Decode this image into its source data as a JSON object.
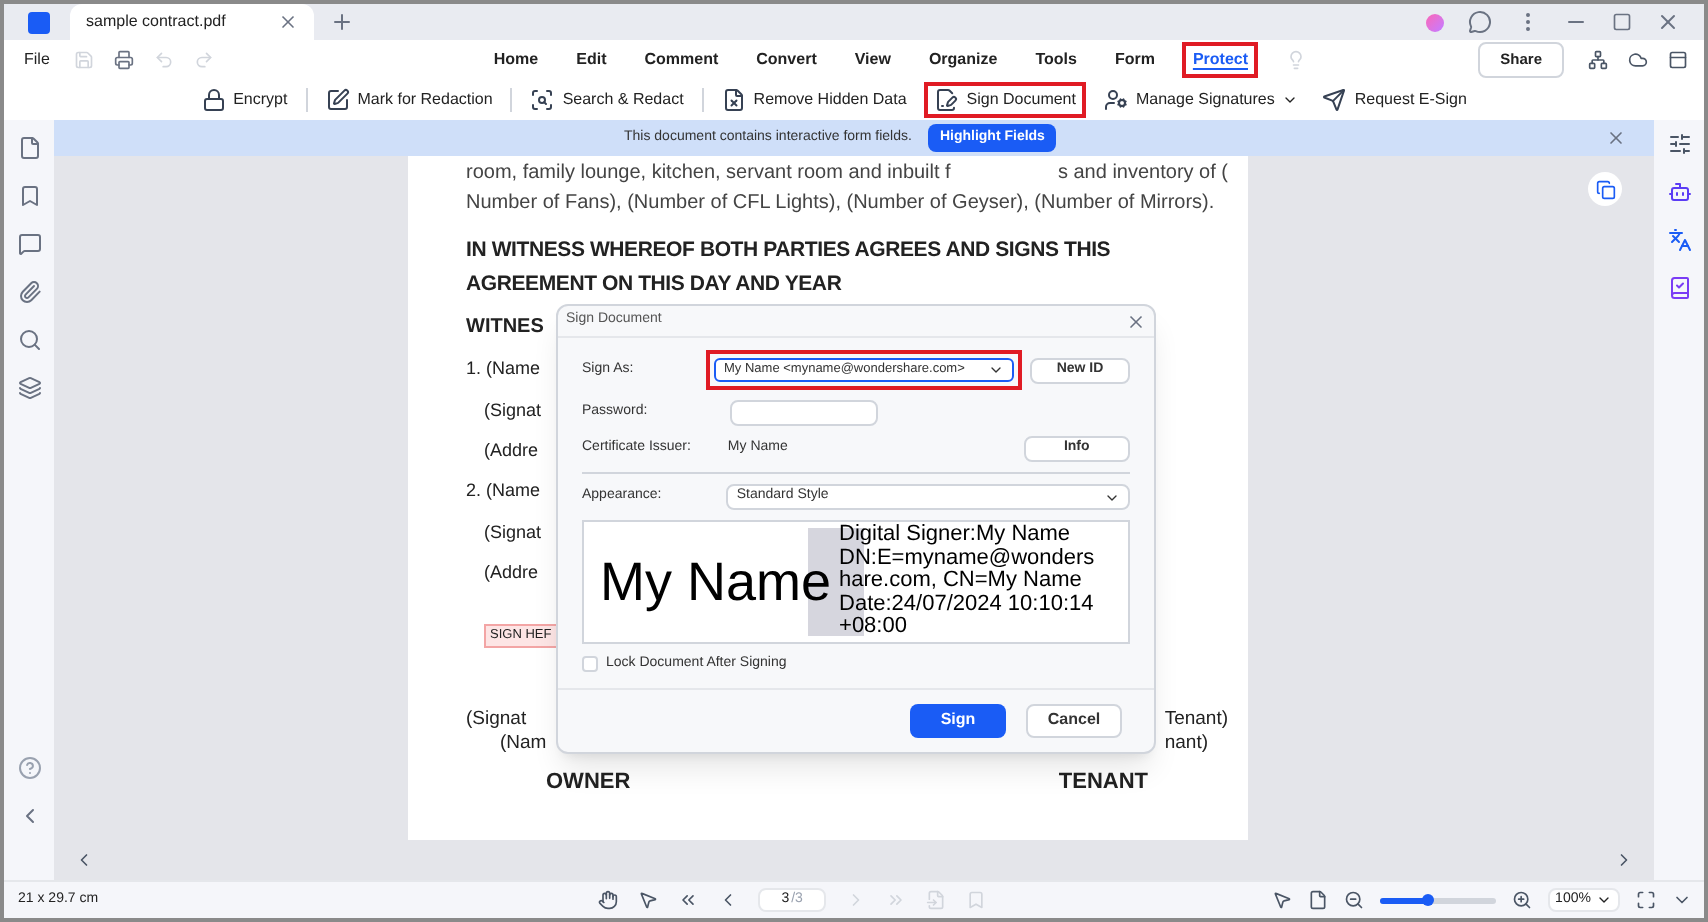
{
  "window": {
    "tab_title": "sample contract.pdf"
  },
  "menu": {
    "file": "File",
    "tabs": [
      {
        "label": "Home",
        "selected": false
      },
      {
        "label": "Edit",
        "selected": false
      },
      {
        "label": "Comment",
        "selected": false
      },
      {
        "label": "Convert",
        "selected": false
      },
      {
        "label": "View",
        "selected": false
      },
      {
        "label": "Organize",
        "selected": false
      },
      {
        "label": "Tools",
        "selected": false
      },
      {
        "label": "Form",
        "selected": false
      },
      {
        "label": "Protect",
        "selected": true
      }
    ],
    "share": "Share"
  },
  "toolbar": [
    {
      "kind": "lock",
      "label": "Encrypt",
      "highlighted": false,
      "dropdown": false
    },
    {
      "kind": "redact",
      "label": "Mark for Redaction",
      "highlighted": false,
      "dropdown": false
    },
    {
      "kind": "search",
      "label": "Search & Redact",
      "highlighted": false,
      "dropdown": false
    },
    {
      "kind": "remove",
      "label": "Remove Hidden Data",
      "highlighted": false,
      "dropdown": false
    },
    {
      "kind": "sign",
      "label": "Sign Document",
      "highlighted": true,
      "dropdown": false
    },
    {
      "kind": "manage",
      "label": "Manage Signatures",
      "highlighted": false,
      "dropdown": true
    },
    {
      "kind": "esign",
      "label": "Request E-Sign",
      "highlighted": false,
      "dropdown": false
    }
  ],
  "banner": {
    "text": "This document contains interactive form fields.",
    "button": "Highlight Fields"
  },
  "document": {
    "intro_left": "room, family lounge, kitchen, servant room and inbuilt f",
    "intro_right": "s and inventory of (",
    "intro_line2": "Number of Fans), (Number of CFL Lights), (Number of Geyser), (Number of Mirrors).",
    "heading": "IN WITNESS WHEREOF BOTH PARTIES AGREES AND SIGNS THIS AGREEMENT ON THIS DAY AND YEAR",
    "left_lines": [
      {
        "kind": "sub",
        "text": "WITNES"
      },
      {
        "kind": "item",
        "text": "1. (Name"
      },
      {
        "kind": "indent",
        "text": "(Signat"
      },
      {
        "kind": "indent",
        "text": "(Addre"
      },
      {
        "kind": "item",
        "text": "2. (Name"
      },
      {
        "kind": "indent",
        "text": "(Signat"
      },
      {
        "kind": "indent",
        "text": "(Addre"
      },
      {
        "kind": "field",
        "text": "SIGN HEF"
      }
    ],
    "sign_rows": [
      {
        "left": "(Signat",
        "right": "Tenant)"
      },
      {
        "left": "(Nam",
        "right": "nant)"
      }
    ],
    "owner": "OWNER",
    "tenant": "TENANT"
  },
  "dialog": {
    "title": "Sign Document",
    "sign_as_label": "Sign As:",
    "sign_as_value": "My Name <myname@wondershare.com>",
    "sign_as_highlighted": true,
    "new_id": "New ID",
    "password_label": "Password:",
    "issuer_label": "Certificate Issuer:",
    "issuer_value": "My Name",
    "info": "Info",
    "appearance_label": "Appearance:",
    "appearance_value": "Standard Style",
    "preview_name": "My Name",
    "preview_lines": [
      "Digital Signer:My Name",
      "DN:E=myname@wonders",
      "hare.com, CN=My Name",
      "Date:24/07/2024 10:10:14",
      "+08:00"
    ],
    "lock_label": "Lock Document After Signing",
    "lock_checked": false,
    "sign": "Sign",
    "cancel": "Cancel"
  },
  "status_bar": {
    "page_size": "21 x 29.7 cm",
    "page_current": "3",
    "page_total": "/3",
    "zoom_slider": {
      "level": 0.42
    },
    "zoom": "100%"
  }
}
